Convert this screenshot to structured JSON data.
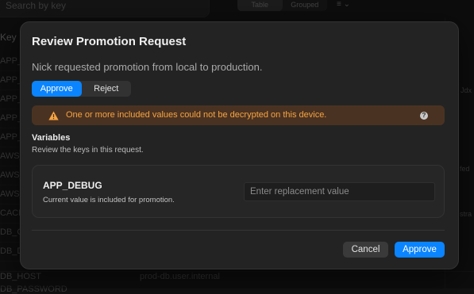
{
  "background": {
    "search_placeholder": "Search by key",
    "view_tabs": [
      "Table",
      "Grouped"
    ],
    "filter_icon": "sort-icon",
    "column_header": "Key",
    "keys": [
      "APP_",
      "APP_",
      "APP_",
      "APP_",
      "APP_",
      "AWS_",
      "AWS_",
      "AWS_",
      "CACH",
      "DB_C",
      "DB_D"
    ],
    "bottom_row": {
      "key": "DB_HOST",
      "value": "prod-db.user.internal",
      "key2": "DB_PASSWORD",
      "value2": ""
    },
    "right_fragments": [
      "Jdx",
      "fed",
      "stra"
    ]
  },
  "modal": {
    "title": "Review Promotion Request",
    "subtitle": "Nick requested promotion from local to production.",
    "decision_options": [
      {
        "label": "Approve",
        "selected": true
      },
      {
        "label": "Reject",
        "selected": false
      }
    ],
    "warning": {
      "icon": "warning-triangle-icon",
      "text": "One or more included values could not be decrypted on this device.",
      "help_icon": "help-icon",
      "help_glyph": "?"
    },
    "section": {
      "title": "Variables",
      "subtitle": "Review the keys in this request."
    },
    "variables": [
      {
        "key": "APP_DEBUG",
        "description": "Current value is included for promotion.",
        "replacement_placeholder": "Enter replacement value",
        "replacement_value": ""
      }
    ],
    "footer": {
      "cancel_label": "Cancel",
      "approve_label": "Approve"
    }
  },
  "colors": {
    "accent": "#0a84ff",
    "warning_text": "#f5a442",
    "warning_bg": "#4a3222",
    "modal_bg": "#232323"
  }
}
